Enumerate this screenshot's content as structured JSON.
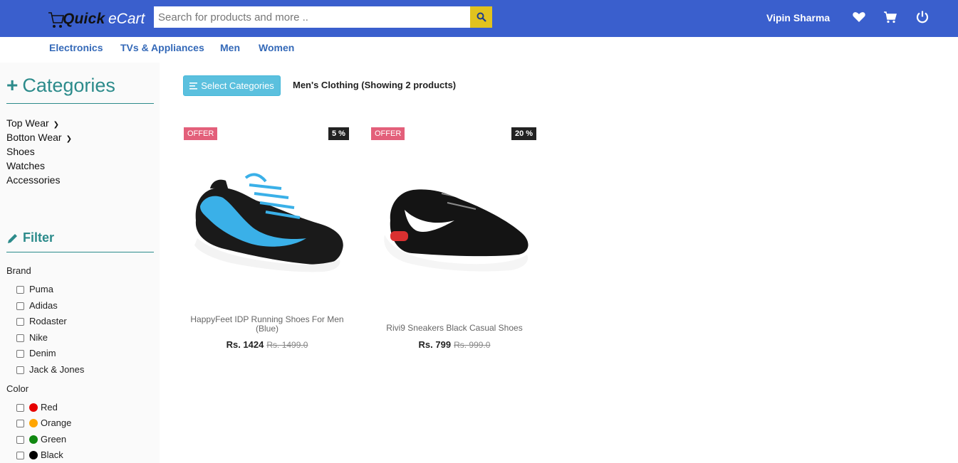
{
  "header": {
    "logo_part1": "Quick",
    "logo_part2": "eCart",
    "search_placeholder": "Search for products and more ..",
    "user_name": "Vipin Sharma"
  },
  "nav": [
    "Electronics",
    "TVs & Appliances",
    "Men",
    "Women"
  ],
  "sidebar": {
    "categories_title": "Categories",
    "categories": [
      "Top Wear",
      "Botton Wear",
      "Shoes",
      "Watches",
      "Accessories"
    ],
    "filter_title": "Filter",
    "brand_label": "Brand",
    "brands": [
      "Puma",
      "Adidas",
      "Rodaster",
      "Nike",
      "Denim",
      "Jack & Jones"
    ],
    "color_label": "Color",
    "colors": [
      {
        "name": "Red",
        "hex": "#e60000"
      },
      {
        "name": "Orange",
        "hex": "#ffa500"
      },
      {
        "name": "Green",
        "hex": "#118811"
      },
      {
        "name": "Black",
        "hex": "#000000"
      }
    ]
  },
  "main": {
    "select_button": "Select Categories",
    "heading": "Men's Clothing (Showing 2 products)"
  },
  "products": [
    {
      "offer": "OFFER",
      "discount": "5 %",
      "name": "HappyFeet IDP Running Shoes For Men (Blue)",
      "price": "Rs. 1424",
      "old_price": "Rs. 1499.0"
    },
    {
      "offer": "OFFER",
      "discount": "20 %",
      "name": "Rivi9 Sneakers Black Casual Shoes",
      "price": "Rs. 799",
      "old_price": "Rs. 999.0"
    }
  ],
  "colors": {
    "header_bg": "#3a5fcd",
    "search_btn": "#e1c21e",
    "nav_link": "#3469b8",
    "accent_teal": "#2c8b8b",
    "offer_badge": "#e35f7a",
    "select_button": "#5bc0de"
  }
}
